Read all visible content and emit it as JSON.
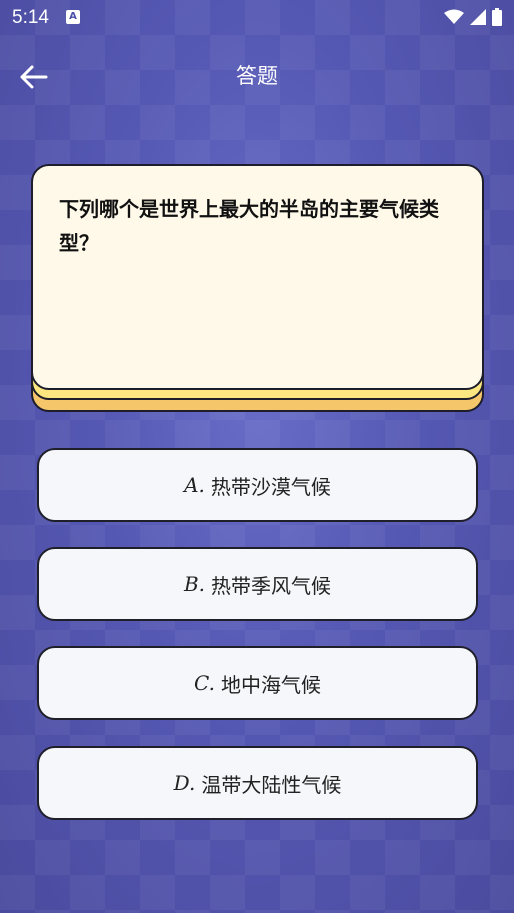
{
  "status": {
    "time": "5:14",
    "app_badge": "A"
  },
  "appbar": {
    "title": "答题"
  },
  "question": {
    "text": "下列哪个是世界上最大的半岛的主要气候类型？"
  },
  "options": [
    {
      "letter": "A.",
      "text": "热带沙漠气候"
    },
    {
      "letter": "B.",
      "text": "热带季风气候"
    },
    {
      "letter": "C.",
      "text": "地中海气候"
    },
    {
      "letter": "D.",
      "text": "温带大陆性气候"
    }
  ],
  "colors": {
    "background": "#5558b3",
    "card": "#fef9e8",
    "card_layer_mid": "#fbe67f",
    "card_layer_bottom": "#f5c66a",
    "option_bg": "#f6f7fa"
  }
}
